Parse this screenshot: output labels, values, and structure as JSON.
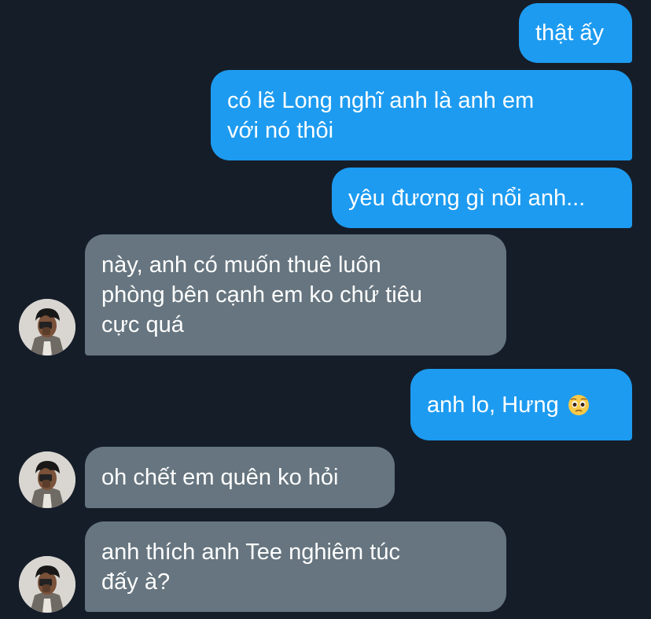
{
  "messages": [
    {
      "direction": "outgoing",
      "text": "thật ấy"
    },
    {
      "direction": "outgoing",
      "text": "có lẽ Long nghĩ anh là anh em\nvới nó thôi"
    },
    {
      "direction": "outgoing",
      "text": "yêu đương gì nổi anh..."
    },
    {
      "direction": "incoming",
      "text": "này, anh có muốn thuê luôn\nphòng bên cạnh em ko chứ tiêu\ncực quá"
    },
    {
      "direction": "outgoing",
      "text": "anh lo, Hưng",
      "emoji": "pleading-face-emoji"
    },
    {
      "direction": "incoming",
      "text": "oh chết em quên ko hỏi"
    },
    {
      "direction": "incoming",
      "text": "anh thích anh Tee nghiêm túc\nđấy à?"
    }
  ],
  "colors": {
    "background": "#151d29",
    "outgoing_bubble": "#1d9bf0",
    "incoming_bubble": "#66757f",
    "text": "#ffffff"
  },
  "avatar": {
    "icon": "user-avatar-photo"
  }
}
